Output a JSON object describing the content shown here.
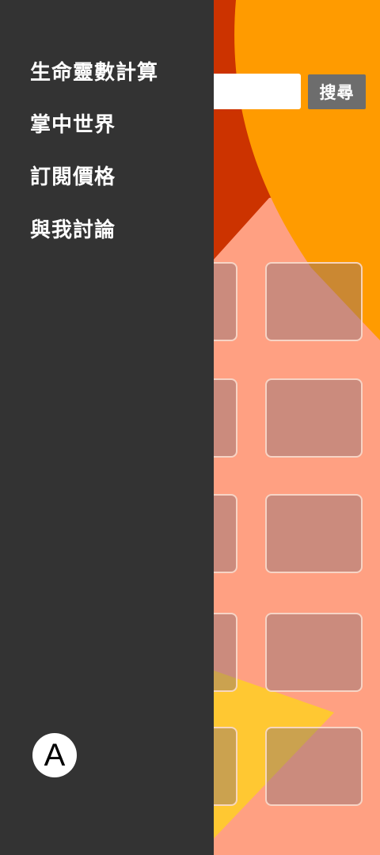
{
  "search": {
    "placeholder": "",
    "value": "",
    "button_label": "搜尋"
  },
  "drawer": {
    "items": [
      {
        "label": "生命靈數計算"
      },
      {
        "label": "掌中世界"
      },
      {
        "label": "訂閱價格"
      },
      {
        "label": "與我討論"
      }
    ],
    "avatar_letter": "A"
  },
  "colors": {
    "drawer_bg": "#333333",
    "search_button_bg": "#6d6d6d",
    "orange_shape": "#ff9b00",
    "red_shape": "#cc3300",
    "salmon_bg": "#ffa082",
    "yellow_shape": "#ffc832"
  }
}
